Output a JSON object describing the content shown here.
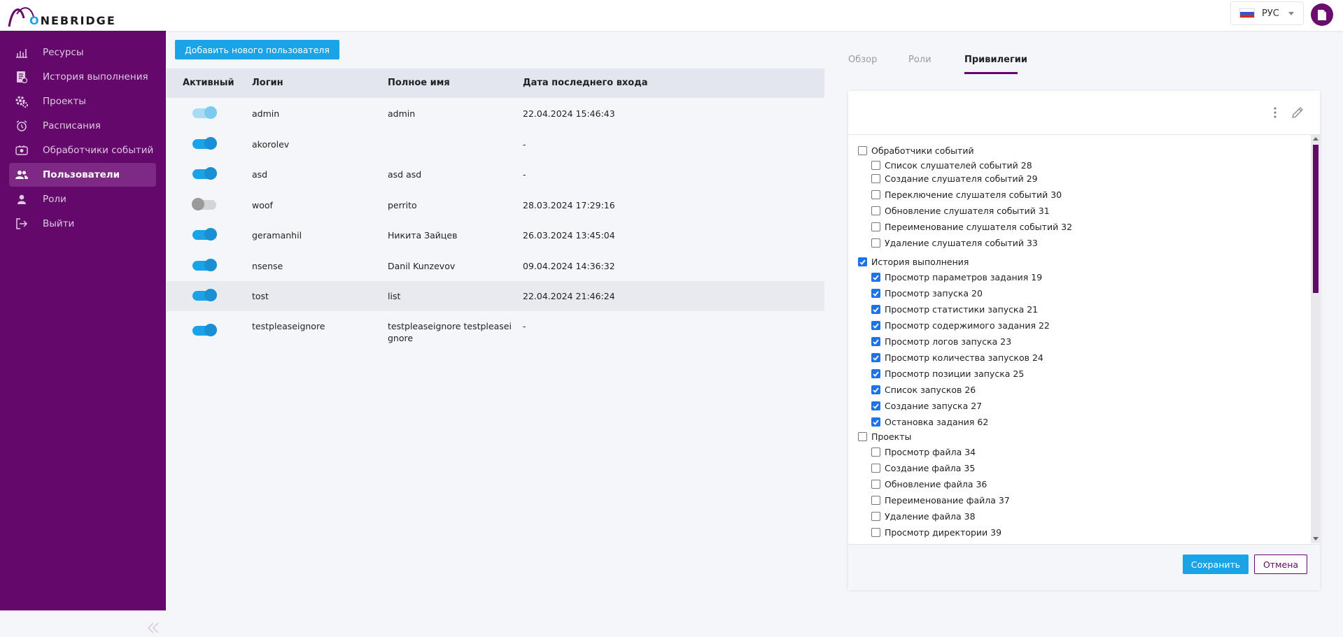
{
  "header": {
    "logo_text": "ONEBRIDGE",
    "language": "РУС",
    "language_flag": "russia-flag-icon",
    "user_icon": "document-icon"
  },
  "colors": {
    "sidebar_bg": "#64086b",
    "accent": "#1aa3e6",
    "checkbox": "#1a73e8"
  },
  "sidebar": {
    "items": [
      {
        "label": "Ресурсы",
        "icon": "chart-icon",
        "active": false
      },
      {
        "label": "История выполнения",
        "icon": "history-icon",
        "active": false
      },
      {
        "label": "Проекты",
        "icon": "gears-icon",
        "active": false
      },
      {
        "label": "Расписания",
        "icon": "alarm-clock-icon",
        "active": false
      },
      {
        "label": "Обработчики событий",
        "icon": "event-handler-icon",
        "active": false
      },
      {
        "label": "Пользователи",
        "icon": "users-icon",
        "active": true
      },
      {
        "label": "Роли",
        "icon": "role-icon",
        "active": false
      },
      {
        "label": "Выйти",
        "icon": "logout-icon",
        "active": false
      }
    ],
    "collapse_icon": "double-chevron-left-icon"
  },
  "users": {
    "add_button": "Добавить нового пользователя",
    "columns": [
      "Активный",
      "Логин",
      "Полное имя",
      "Дата последнего входа"
    ],
    "rows": [
      {
        "active": "on-light",
        "login": "admin",
        "full_name": "admin",
        "last_login": "22.04.2024 15:46:43"
      },
      {
        "active": "on",
        "login": "akorolev",
        "full_name": "",
        "last_login": "-"
      },
      {
        "active": "on",
        "login": "asd",
        "full_name": "asd asd",
        "last_login": "-"
      },
      {
        "active": "off",
        "login": "woof",
        "full_name": "perrito",
        "last_login": "28.03.2024 17:29:16"
      },
      {
        "active": "on",
        "login": "geramanhil",
        "full_name": "Никита Зайцев",
        "last_login": "26.03.2024 13:45:04"
      },
      {
        "active": "on",
        "login": "nsense",
        "full_name": "Danil Kunzevov",
        "last_login": "09.04.2024 14:36:32"
      },
      {
        "active": "on",
        "login": "tost",
        "full_name": "list",
        "last_login": "22.04.2024 21:46:24",
        "highlighted": true
      },
      {
        "active": "on",
        "login": "testpleaseignore",
        "full_name_line1": "testpleaseignore testpleasei",
        "full_name_line2": "gnore",
        "last_login": "-"
      }
    ]
  },
  "details": {
    "tabs": [
      "Обзор",
      "Роли",
      "Привилегии"
    ],
    "active_tab": "Привилегии",
    "groups": [
      {
        "label": "Обработчики событий",
        "checked": false,
        "items": [
          {
            "label": "Список слушателей событий 28",
            "checked": false
          },
          {
            "label": "Создание слушателя событий 29",
            "checked": false
          },
          {
            "label": "Переключение слушателя событий 30",
            "checked": false
          },
          {
            "label": "Обновление слушателя событий 31",
            "checked": false
          },
          {
            "label": "Переименование слушателя событий 32",
            "checked": false
          },
          {
            "label": "Удаление слушателя событий 33",
            "checked": false
          }
        ]
      },
      {
        "label": "История выполнения",
        "checked": true,
        "items": [
          {
            "label": "Просмотр параметров задания 19",
            "checked": true
          },
          {
            "label": "Просмотр запуска 20",
            "checked": true
          },
          {
            "label": "Просмотр статистики запуска 21",
            "checked": true
          },
          {
            "label": "Просмотр содержимого задания 22",
            "checked": true
          },
          {
            "label": "Просмотр логов запуска 23",
            "checked": true
          },
          {
            "label": "Просмотр количества запусков 24",
            "checked": true
          },
          {
            "label": "Просмотр позиции запуска 25",
            "checked": true
          },
          {
            "label": "Список запусков 26",
            "checked": true
          },
          {
            "label": "Создание запуска 27",
            "checked": true
          },
          {
            "label": "Остановка задания 62",
            "checked": true
          }
        ]
      },
      {
        "label": "Проекты",
        "checked": false,
        "items": [
          {
            "label": "Просмотр файла 34",
            "checked": false
          },
          {
            "label": "Создание файла 35",
            "checked": false
          },
          {
            "label": "Обновление файла 36",
            "checked": false
          },
          {
            "label": "Переименование файла 37",
            "checked": false
          },
          {
            "label": "Удаление файла 38",
            "checked": false
          },
          {
            "label": "Просмотр директории 39",
            "checked": false
          }
        ]
      }
    ],
    "save_button": "Сохранить",
    "cancel_button": "Отмена"
  }
}
